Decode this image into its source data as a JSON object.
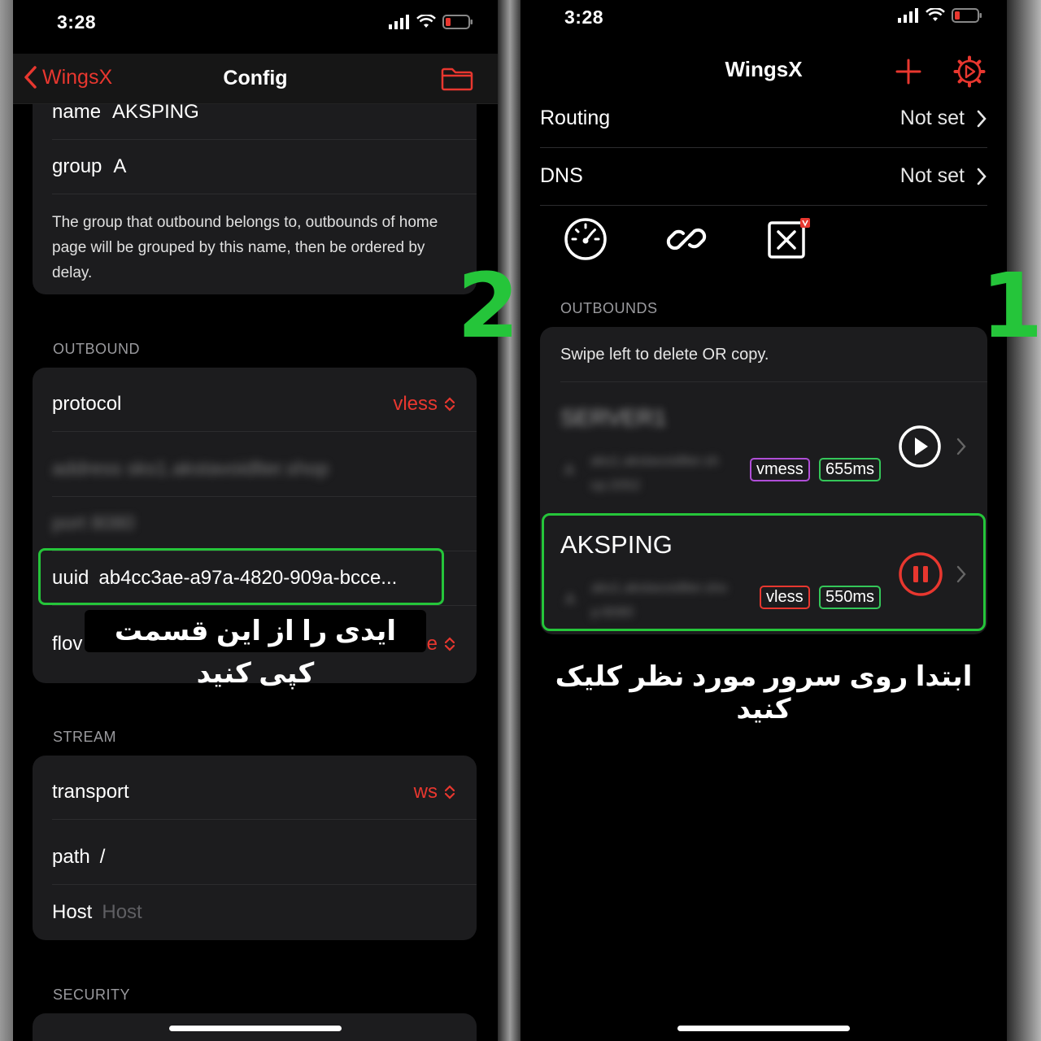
{
  "left_phone": {
    "status_time": "3:28",
    "back_label": "WingsX",
    "title": "Config",
    "fields": {
      "name_label": "name",
      "name_value": "AKSPING",
      "group_label": "group",
      "group_value": "A",
      "group_help": "The group that outbound belongs to, outbounds of home page will be grouped by this name, then be ordered by delay."
    },
    "outbound_section": "OUTBOUND",
    "outbound": {
      "protocol_label": "protocol",
      "protocol_value": "vless",
      "address_blurred": "address  sks1.akstavoidlter.shop",
      "port_blurred": "port  8080",
      "uuid_label": "uuid",
      "uuid_value": "ab4cc3ae-a97a-4820-909a-bcce...",
      "flow_label": "flov",
      "flow_value_tail": "e"
    },
    "stream_section": "STREAM",
    "stream": {
      "transport_label": "transport",
      "transport_value": "ws",
      "path_label": "path",
      "path_value": "/",
      "host_label": "Host",
      "host_placeholder": "Host"
    },
    "security_section": "SECURITY",
    "caption": "ایدی را از این قسمت کپی کنید",
    "step_number": "2"
  },
  "right_phone": {
    "status_time": "3:28",
    "title": "WingsX",
    "routing_label": "Routing",
    "routing_value": "Not set",
    "dns_label": "DNS",
    "dns_value": "Not set",
    "outbounds_section": "OUTBOUNDS",
    "hint": "Swipe left to delete OR copy.",
    "servers": [
      {
        "name_blurred": "SERVER1",
        "group_blurred": "A",
        "addr_blurred": "aks1.akstavoidlter.sh",
        "addr2_blurred": "op:2052",
        "protocol": "vmess",
        "delay": "655ms"
      },
      {
        "name": "AKSPING",
        "group_blurred": "A",
        "addr_blurred": "aks1.akstavoidlter.sho",
        "addr2_blurred": "p:8080",
        "protocol": "vless",
        "delay": "550ms"
      }
    ],
    "caption": "ابتدا روی سرور مورد نظر کلیک کنید",
    "step_number": "1"
  },
  "colors": {
    "accent_red": "#e8372f",
    "highlight_green": "#25c53a",
    "vmess_border": "#b04ed8",
    "delay_border": "#34c759"
  }
}
